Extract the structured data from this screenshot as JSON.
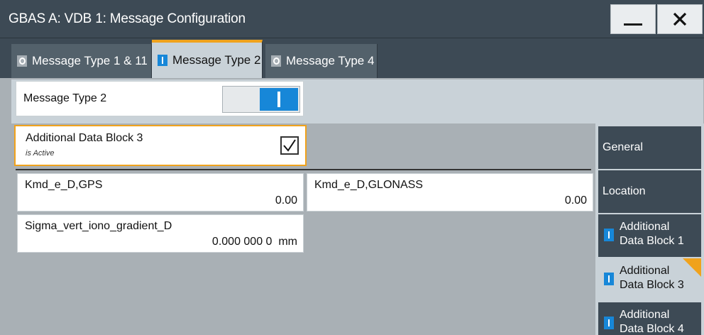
{
  "window": {
    "title": "GBAS A: VDB 1: Message Configuration"
  },
  "tabs": [
    {
      "label": "Message Type 1 & 11",
      "state": "off"
    },
    {
      "label": "Message Type 2",
      "state": "on",
      "active": true
    },
    {
      "label": "Message Type 4",
      "state": "off"
    }
  ],
  "message_type_2": {
    "label": "Message Type 2",
    "enabled": true
  },
  "additional_data_block": {
    "label": "Additional Data Block 3",
    "sublabel": "is Active",
    "checked": true
  },
  "fields": {
    "kmd_gps": {
      "label": "Kmd_e_D,GPS",
      "value": "0.00"
    },
    "kmd_glonass": {
      "label": "Kmd_e_D,GLONASS",
      "value": "0.00"
    },
    "sigma": {
      "label": "Sigma_vert_iono_gradient_D",
      "value": "0.000 000 0  mm"
    }
  },
  "side_nav": [
    {
      "label": "General"
    },
    {
      "label": "Location"
    },
    {
      "line1": "Additional",
      "line2": "Data Block 1"
    },
    {
      "line1": "Additional",
      "line2": "Data Block 3",
      "active": true
    },
    {
      "line1": "Additional",
      "line2": "Data Block 4"
    }
  ],
  "colors": {
    "accent": "#f0a21c",
    "active_indicator": "#1787d8",
    "title_bar": "#3d4a55"
  },
  "icons": {
    "minimize": "minimize-icon",
    "close": "close-icon",
    "check": "checkmark-icon"
  }
}
